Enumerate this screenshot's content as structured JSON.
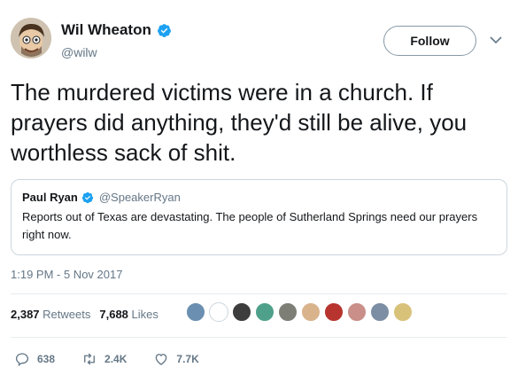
{
  "author": {
    "display_name": "Wil Wheaton",
    "handle": "@wilw",
    "verified": true
  },
  "follow_button": {
    "label": "Follow"
  },
  "tweet": {
    "text": "The murdered victims were in a church. If prayers did anything, they'd still be alive, you worthless sack of shit."
  },
  "quoted_tweet": {
    "display_name": "Paul Ryan",
    "handle": "@SpeakerRyan",
    "verified": true,
    "text": "Reports out of Texas are devastating. The people of Sutherland Springs need our prayers right now."
  },
  "timestamp": "1:19 PM - 5 Nov 2017",
  "stats": {
    "retweets_count": "2,387",
    "retweets_label": "Retweets",
    "likes_count": "7,688",
    "likes_label": "Likes"
  },
  "liker_avatars": [
    {
      "name": "avatar-1",
      "color": "#6a8fb0"
    },
    {
      "name": "avatar-2",
      "color": "#ffffff"
    },
    {
      "name": "avatar-3",
      "color": "#3d3d3d"
    },
    {
      "name": "avatar-4",
      "color": "#4fa08a"
    },
    {
      "name": "avatar-5",
      "color": "#7d7f76"
    },
    {
      "name": "avatar-6",
      "color": "#d9b38c"
    },
    {
      "name": "avatar-7",
      "color": "#b8342f"
    },
    {
      "name": "avatar-8",
      "color": "#c98f88"
    },
    {
      "name": "avatar-9",
      "color": "#7b8ea3"
    },
    {
      "name": "avatar-10",
      "color": "#d8c27a"
    }
  ],
  "actions": {
    "reply_count": "638",
    "retweet_count": "2.4K",
    "like_count": "7.7K"
  },
  "colors": {
    "verified_blue": "#1da1f2",
    "text_primary": "#14171a",
    "text_secondary": "#657786",
    "border": "#ccd6dd"
  },
  "icons": [
    "verified-badge-icon",
    "caret-down-icon",
    "reply-icon",
    "retweet-icon",
    "heart-icon"
  ]
}
